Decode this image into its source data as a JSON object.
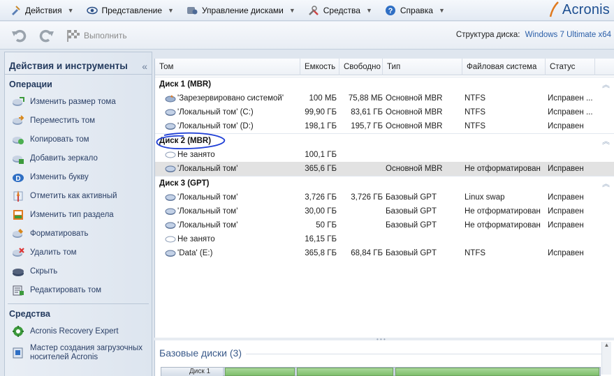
{
  "menu": [
    {
      "label": "Действия",
      "icon": "actions-icon"
    },
    {
      "label": "Представление",
      "icon": "eye-icon"
    },
    {
      "label": "Управление дисками",
      "icon": "disk-management-icon"
    },
    {
      "label": "Средства",
      "icon": "tools-icon"
    },
    {
      "label": "Справка",
      "icon": "help-icon"
    }
  ],
  "logo": {
    "text": "Acronis"
  },
  "toolbar": {
    "commit_label": "Выполнить",
    "disk_structure_label": "Структура диска:",
    "disk_structure_value": "Windows 7 Ultimate x64"
  },
  "sidebar": {
    "title": "Действия и инструменты",
    "collapse_glyph": "«",
    "operations_title": "Операции",
    "operations": [
      {
        "label": "Изменить размер тома",
        "icon": "resize-volume-icon"
      },
      {
        "label": "Переместить том",
        "icon": "move-volume-icon"
      },
      {
        "label": "Копировать том",
        "icon": "copy-volume-icon"
      },
      {
        "label": "Добавить зеркало",
        "icon": "add-mirror-icon"
      },
      {
        "label": "Изменить букву",
        "icon": "change-letter-icon"
      },
      {
        "label": "Отметить как активный",
        "icon": "mark-active-icon"
      },
      {
        "label": "Изменить тип раздела",
        "icon": "change-partition-type-icon"
      },
      {
        "label": "Форматировать",
        "icon": "format-icon"
      },
      {
        "label": "Удалить том",
        "icon": "delete-volume-icon"
      },
      {
        "label": "Скрыть",
        "icon": "hide-icon"
      },
      {
        "label": "Редактировать том",
        "icon": "edit-volume-icon"
      }
    ],
    "tools_title": "Средства",
    "tools": [
      {
        "label": "Acronis Recovery Expert",
        "icon": "recovery-expert-icon"
      },
      {
        "label_line1": "Мастер создания загрузочных",
        "label_line2": "носителей Acronis",
        "icon": "bootable-media-icon"
      }
    ]
  },
  "table": {
    "headers": {
      "volume": "Том",
      "capacity": "Емкость",
      "free": "Свободно",
      "type": "Тип",
      "fs": "Файловая система",
      "status": "Статус"
    },
    "groups": [
      {
        "name": "Диск 1 (MBR)",
        "rows": [
          {
            "volume": "'Зарезервировано системой'",
            "capacity": "100 МБ",
            "free": "75,88 МБ",
            "type": "Основной MBR",
            "fs": "NTFS",
            "status": "Исправен ...",
            "icon": "system-volume-icon"
          },
          {
            "volume": "'Локальный том' (C:)",
            "capacity": "99,90 ГБ",
            "free": "83,61 ГБ",
            "type": "Основной MBR",
            "fs": "NTFS",
            "status": "Исправен ...",
            "icon": "volume-icon"
          },
          {
            "volume": "'Локальный том' (D:)",
            "capacity": "198,1 ГБ",
            "free": "195,7 ГБ",
            "type": "Основной MBR",
            "fs": "NTFS",
            "status": "Исправен",
            "icon": "volume-icon"
          }
        ]
      },
      {
        "name": "Диск 2 (MBR)",
        "rows": [
          {
            "volume": "Не занято",
            "capacity": "100,1 ГБ",
            "free": "",
            "type": "",
            "fs": "",
            "status": "",
            "icon": "unallocated-icon"
          },
          {
            "volume": "'Локальный том'",
            "capacity": "365,6 ГБ",
            "free": "",
            "type": "Основной MBR",
            "fs": "Не отформатирован",
            "status": "Исправен",
            "icon": "volume-icon",
            "selected": true
          }
        ]
      },
      {
        "name": "Диск 3 (GPT)",
        "rows": [
          {
            "volume": "'Локальный том'",
            "capacity": "3,726 ГБ",
            "free": "3,726 ГБ",
            "type": "Базовый GPT",
            "fs": "Linux swap",
            "status": "Исправен",
            "icon": "volume-icon"
          },
          {
            "volume": "'Локальный том'",
            "capacity": "30,00 ГБ",
            "free": "",
            "type": "Базовый GPT",
            "fs": "Не отформатирован",
            "status": "Исправен",
            "icon": "volume-icon"
          },
          {
            "volume": "'Локальный том'",
            "capacity": "50 ГБ",
            "free": "",
            "type": "Базовый GPT",
            "fs": "Не отформатирован",
            "status": "Исправен",
            "icon": "volume-icon"
          },
          {
            "volume": "Не занято",
            "capacity": "16,15 ГБ",
            "free": "",
            "type": "",
            "fs": "",
            "status": "",
            "icon": "unallocated-icon"
          },
          {
            "volume": "'Data' (E:)",
            "capacity": "365,8 ГБ",
            "free": "68,84 ГБ",
            "type": "Базовый GPT",
            "fs": "NTFS",
            "status": "Исправен",
            "icon": "volume-icon"
          }
        ]
      }
    ]
  },
  "bottom": {
    "title": "Базовые диски (3)",
    "disk_label": "Диск 1"
  },
  "colors": {
    "accent": "#2a5ea8",
    "annotation": "#1f3fd6",
    "partition_green": "#8cc97a",
    "selected_row": "#e2e2e2"
  }
}
